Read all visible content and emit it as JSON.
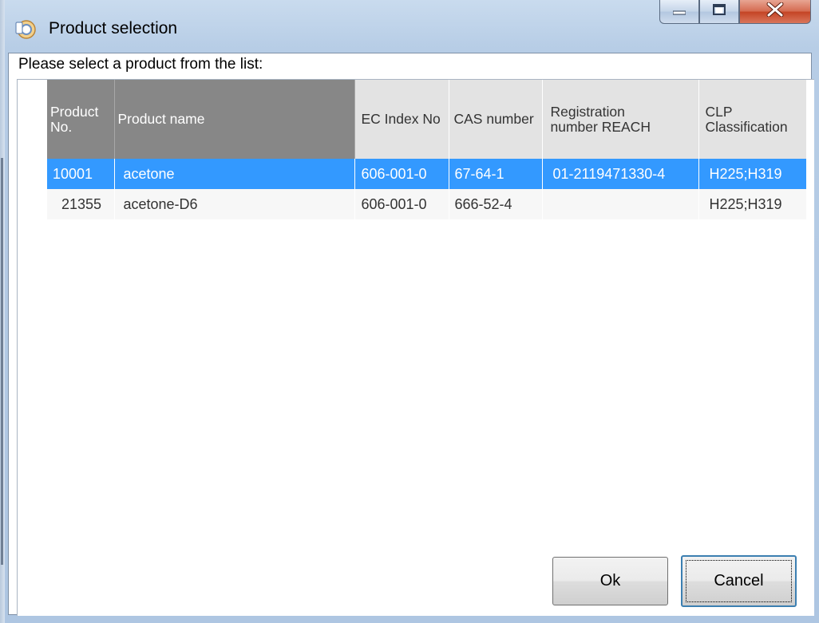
{
  "window": {
    "title": "Product selection",
    "icon": "product-selection-icon",
    "controls": {
      "minimize": "minimize-icon",
      "maximize": "maximize-icon",
      "close": "close-icon"
    }
  },
  "prompt": "Please select a product from the list:",
  "table": {
    "columns": [
      {
        "label": "Product No."
      },
      {
        "label": "Product name"
      },
      {
        "label": "EC Index No"
      },
      {
        "label": "CAS number"
      },
      {
        "label": "Registration number REACH"
      },
      {
        "label": "CLP Classification"
      }
    ],
    "rows": [
      {
        "cells": [
          "10001",
          "acetone",
          "606-001-0",
          "67-64-1",
          "01-2119471330-4",
          "H225;H319"
        ],
        "selected": true
      },
      {
        "cells": [
          "21355",
          "acetone-D6",
          "606-001-0",
          "666-52-4",
          "",
          "H225;H319"
        ],
        "selected": false
      }
    ]
  },
  "buttons": {
    "ok": "Ok",
    "cancel": "Cancel"
  },
  "colors": {
    "selection": "#3399ff",
    "header_dark": "#878787",
    "header_light": "#e3e3e3"
  }
}
